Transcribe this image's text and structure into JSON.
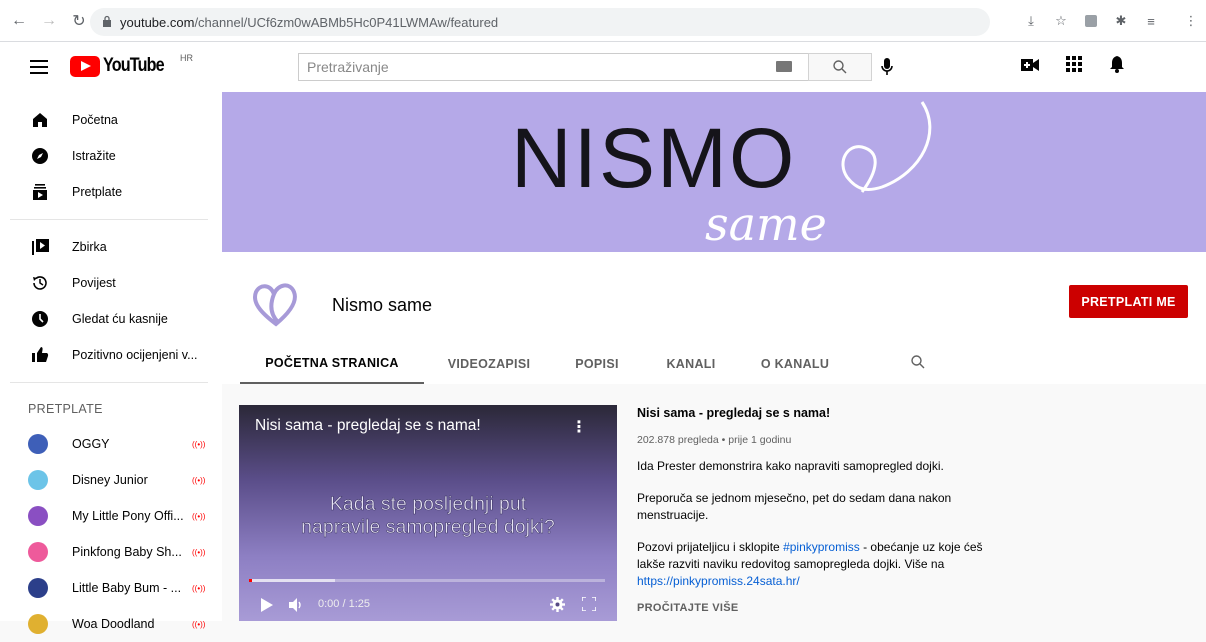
{
  "browser": {
    "url_host": "youtube.com",
    "url_path": "/channel/UCf6zm0wABMb5Hc0P41LWMAw/featured"
  },
  "yt": {
    "logo_text": "YouTube",
    "country_code": "HR",
    "search_placeholder": "Pretraživanje"
  },
  "sidebar": {
    "main": [
      {
        "label": "Početna",
        "icon": "home-icon"
      },
      {
        "label": "Istražite",
        "icon": "compass-icon"
      },
      {
        "label": "Pretplate",
        "icon": "subscriptions-icon"
      }
    ],
    "library": [
      {
        "label": "Zbirka",
        "icon": "library-icon"
      },
      {
        "label": "Povijest",
        "icon": "history-icon"
      },
      {
        "label": "Gledat ću kasnije",
        "icon": "clock-icon"
      },
      {
        "label": "Pozitivno ocijenjeni v...",
        "icon": "thumbs-up-icon"
      }
    ],
    "subs_heading": "PRETPLATE",
    "subs": [
      {
        "name": "OGGY",
        "live": "((•))",
        "color": "#3e5fb8"
      },
      {
        "name": "Disney Junior",
        "live": "((•))",
        "color": "#6cc4e8"
      },
      {
        "name": "My Little Pony Offi...",
        "live": "((•))",
        "color": "#8a4fc2"
      },
      {
        "name": "Pinkfong Baby Sh...",
        "live": "((•))",
        "color": "#ee5a9b"
      },
      {
        "name": "Little Baby Bum - ...",
        "live": "((•))",
        "color": "#2c3f8a"
      },
      {
        "name": "Woa Doodland",
        "live": "((•))",
        "color": "#e0b030"
      }
    ]
  },
  "banner": {
    "title": "NISMO",
    "script": "same",
    "bg": "#b5a9e8"
  },
  "channel": {
    "name": "Nismo same",
    "subscribe_label": "PRETPLATI ME",
    "tabs": [
      {
        "label": "POČETNA STRANICA",
        "active": true
      },
      {
        "label": "VIDEOZAPISI"
      },
      {
        "label": "POPISI"
      },
      {
        "label": "KANALI"
      },
      {
        "label": "O KANALU"
      }
    ]
  },
  "video": {
    "player_title": "Nisi sama - pregledaj se s nama!",
    "overlay_line1": "Kada ste posljednji put",
    "overlay_line2": "napravile samopregled dojki?",
    "time": "0:00 / 1:25",
    "progress_fraction": 0.0,
    "title": "Nisi sama - pregledaj se s nama!",
    "meta": "202.878 pregleda • prije 1 godinu",
    "desc1": "Ida Prester demonstrira kako napraviti samopregled dojki.",
    "desc2": "Preporuča se jednom mjesečno, pet do sedam dana nakon menstruacije.",
    "desc3_pre": "Pozovi prijateljicu i sklopite ",
    "desc3_tag": "#pinkypromiss",
    "desc3_post": " - obećanje uz koje ćeš lakše razviti naviku redovitog samopregleda dojki. Više na ",
    "desc3_link": "https://pinkypromiss.24sata.hr/",
    "read_more": "PROČITAJTE VIŠE"
  }
}
